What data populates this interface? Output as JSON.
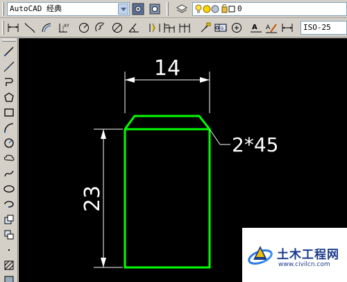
{
  "toolbar_top": {
    "workspace_select": "AutoCAD 经典",
    "layer_select": "0"
  },
  "toolbar_dims": {
    "dimstyle_select": "ISO-25"
  },
  "drawing": {
    "dim_width": "14",
    "dim_height": "23",
    "chamfer_label": "2*45",
    "outline_color": "#00ff00",
    "dimension_color": "#ffffff"
  },
  "watermark": {
    "name": "土木工程网",
    "url": "www.civilcn.com"
  }
}
